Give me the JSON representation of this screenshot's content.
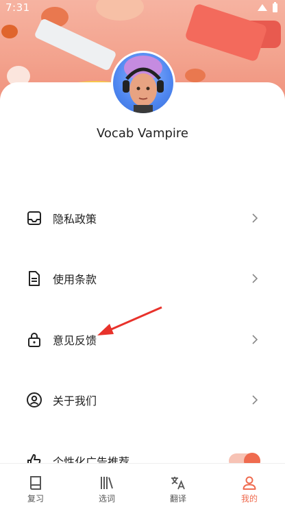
{
  "status_bar": {
    "time": "7:31"
  },
  "profile": {
    "username": "Vocab Vampire"
  },
  "menu": {
    "items": [
      {
        "label": "隐私政策",
        "icon": "inbox-icon"
      },
      {
        "label": "使用条款",
        "icon": "document-icon"
      },
      {
        "label": "意见反馈",
        "icon": "lock-icon"
      },
      {
        "label": "关于我们",
        "icon": "user-circle-icon"
      }
    ],
    "toggle_item": {
      "label": "个性化广告推荐",
      "icon": "thumbs-up-icon",
      "enabled": true
    }
  },
  "bottom_nav": {
    "items": [
      {
        "label": "复习",
        "icon": "book-icon"
      },
      {
        "label": "选词",
        "icon": "books-icon"
      },
      {
        "label": "翻译",
        "icon": "translate-icon"
      },
      {
        "label": "我的",
        "icon": "person-icon",
        "active": true
      }
    ]
  },
  "colors": {
    "accent": "#ef6b4f",
    "banner": "#f3a28d",
    "annotation_arrow": "#e8322b"
  }
}
